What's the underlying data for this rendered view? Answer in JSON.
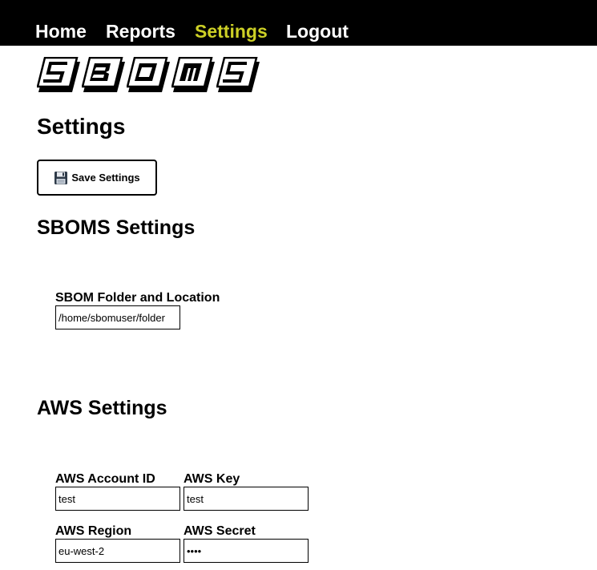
{
  "nav": {
    "items": [
      {
        "label": "Home",
        "active": false
      },
      {
        "label": "Reports",
        "active": false
      },
      {
        "label": "Settings",
        "active": true
      },
      {
        "label": "Logout",
        "active": false
      }
    ],
    "active_color": "#cdd026",
    "background": "#000000"
  },
  "logo": {
    "letters": [
      "S",
      "B",
      "O",
      "M",
      "S"
    ]
  },
  "page": {
    "title": "Settings"
  },
  "toolbar": {
    "save_icon": "floppy-disk-icon",
    "save_label": "Save Settings"
  },
  "sboms_section": {
    "heading": "SBOMS Settings",
    "folder_label": "SBOM Folder and Location",
    "folder_value": "/home/sbomuser/folder"
  },
  "aws_section": {
    "heading": "AWS Settings",
    "account_id_label": "AWS Account ID",
    "account_id_value": "test",
    "key_label": "AWS Key",
    "key_value": "test",
    "region_label": "AWS Region",
    "region_value": "eu-west-2",
    "secret_label": "AWS Secret",
    "secret_value": "test"
  }
}
